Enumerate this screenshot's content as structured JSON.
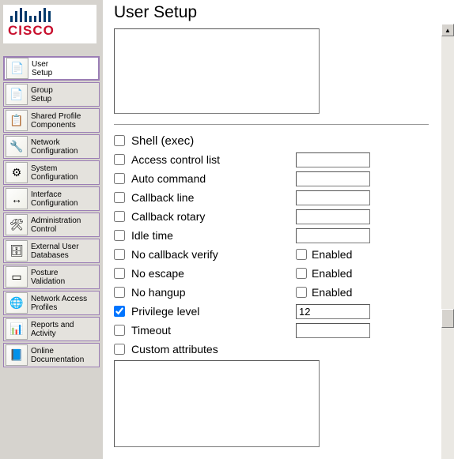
{
  "brand": "CISCO",
  "page_title": "User Setup",
  "sidebar": {
    "items": [
      {
        "label": "User\nSetup",
        "icon": "📄",
        "active": true
      },
      {
        "label": "Group\nSetup",
        "icon": "📄",
        "active": false
      },
      {
        "label": "Shared Profile\nComponents",
        "icon": "📋",
        "active": false
      },
      {
        "label": "Network\nConfiguration",
        "icon": "🔧",
        "active": false
      },
      {
        "label": "System\nConfiguration",
        "icon": "⚙",
        "active": false
      },
      {
        "label": "Interface\nConfiguration",
        "icon": "↔",
        "active": false
      },
      {
        "label": "Administration\nControl",
        "icon": "🛠",
        "active": false
      },
      {
        "label": "External User\nDatabases",
        "icon": "🗄",
        "active": false
      },
      {
        "label": "Posture\nValidation",
        "icon": "▭",
        "active": false
      },
      {
        "label": "Network Access\nProfiles",
        "icon": "🌐",
        "active": false
      },
      {
        "label": "Reports and\nActivity",
        "icon": "📊",
        "active": false
      },
      {
        "label": "Online\nDocumentation",
        "icon": "📘",
        "active": false
      }
    ]
  },
  "form": {
    "top_textarea": "",
    "shell_exec": {
      "label": "Shell (exec)",
      "checked": false
    },
    "rows": [
      {
        "key": "acl",
        "label": "Access control list",
        "checked": false,
        "type": "text",
        "value": ""
      },
      {
        "key": "autocmd",
        "label": "Auto command",
        "checked": false,
        "type": "text",
        "value": ""
      },
      {
        "key": "cbline",
        "label": "Callback line",
        "checked": false,
        "type": "text",
        "value": ""
      },
      {
        "key": "cbrotary",
        "label": "Callback rotary",
        "checked": false,
        "type": "text",
        "value": ""
      },
      {
        "key": "idle",
        "label": "Idle time",
        "checked": false,
        "type": "text",
        "value": ""
      },
      {
        "key": "nocbv",
        "label": "No callback verify",
        "checked": false,
        "type": "enabled",
        "en_label": "Enabled",
        "en_checked": false
      },
      {
        "key": "noesc",
        "label": "No escape",
        "checked": false,
        "type": "enabled",
        "en_label": "Enabled",
        "en_checked": false
      },
      {
        "key": "nohang",
        "label": "No hangup",
        "checked": false,
        "type": "enabled",
        "en_label": "Enabled",
        "en_checked": false
      },
      {
        "key": "priv",
        "label": "Privilege level",
        "checked": true,
        "type": "text",
        "value": "12"
      },
      {
        "key": "timeout",
        "label": "Timeout",
        "checked": false,
        "type": "text",
        "value": ""
      },
      {
        "key": "custom",
        "label": "Custom attributes",
        "checked": false,
        "type": "none"
      }
    ],
    "custom_textarea": ""
  }
}
